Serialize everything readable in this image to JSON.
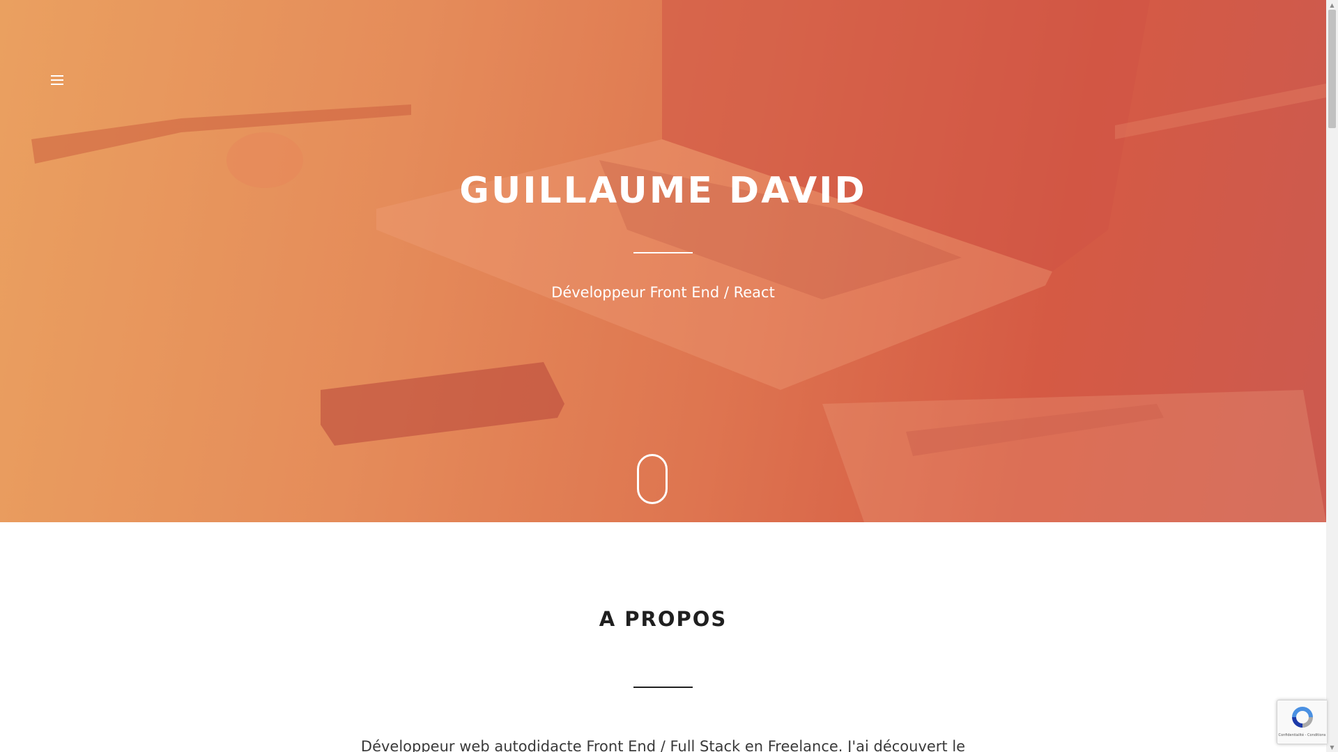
{
  "hero": {
    "title": "Guillaume David",
    "subtitle": "Développeur Front End / React"
  },
  "nav": {
    "menu_icon": "hamburger-menu-icon"
  },
  "about": {
    "title": "A propos",
    "intro": "Développeur web autodidacte Front End / Full Stack en Freelance. J'ai découvert le"
  },
  "recaptcha": {
    "links": "Confidentialité - Conditions"
  },
  "colors": {
    "hero_gradient_start": "#eaa060",
    "hero_gradient_end": "#cc5a4f",
    "heading_dark": "#1f1f1f",
    "white": "#ffffff"
  }
}
